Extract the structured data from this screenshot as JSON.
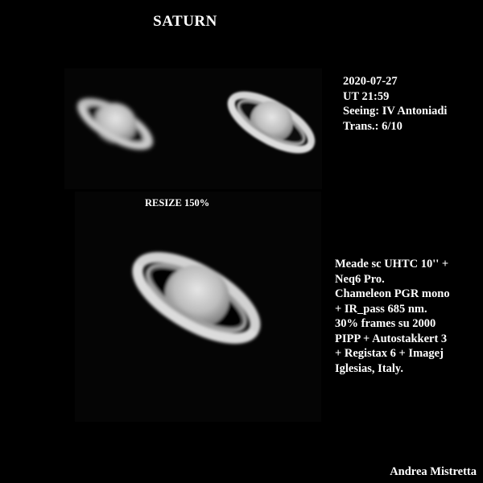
{
  "title": "SATURN",
  "observation": {
    "lines": [
      "2020-07-27",
      "UT 21:59",
      "Seeing: IV Antoniadi",
      "Trans.: 6/10"
    ]
  },
  "resize_label": "RESIZE 150%",
  "equipment": {
    "lines": [
      "Meade sc UHTC 10'' +",
      "Neq6 Pro.",
      "Chameleon PGR mono",
      "+ IR_pass 685 nm.",
      "30% frames su 2000",
      "PIPP + Autostakkert 3",
      "+ Registax 6 + Imagej",
      "Iglesias, Italy."
    ]
  },
  "author": "Andrea Mistretta"
}
